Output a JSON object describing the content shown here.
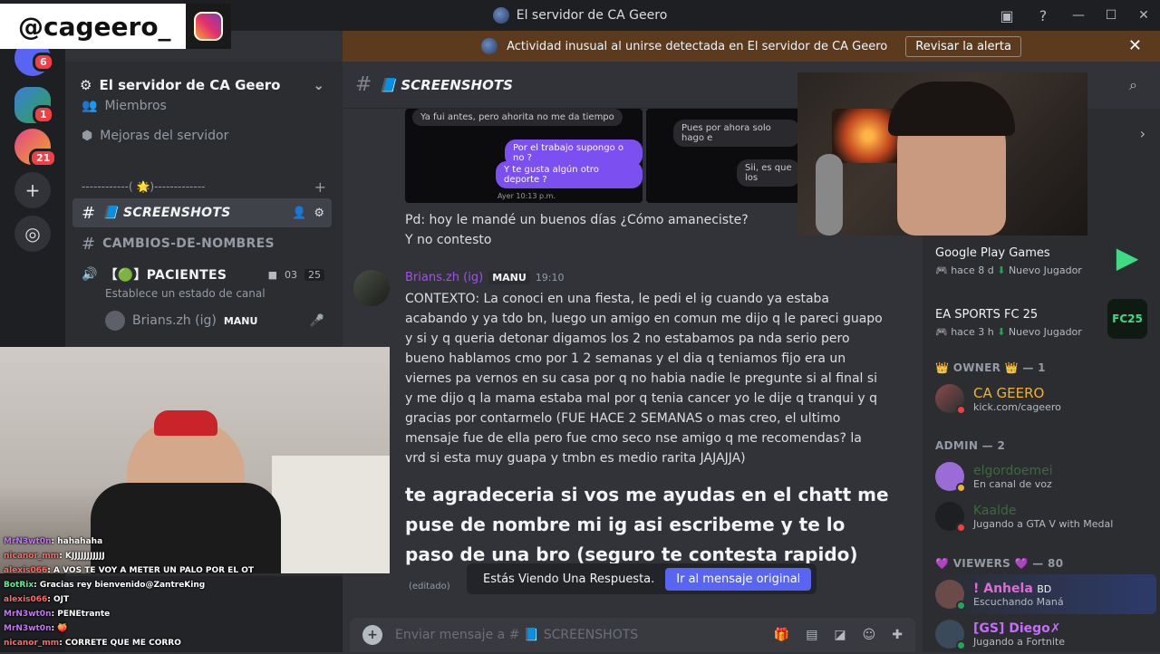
{
  "window": {
    "title": "El servidor de CA Geero"
  },
  "overlay": {
    "handle": "@cageero_"
  },
  "alert": {
    "text": "Actividad inusual al unirse detectada en El servidor de CA Geero",
    "review": "Revisar la alerta",
    "close": "✕"
  },
  "rail": {
    "badges": [
      "6",
      "1",
      "21"
    ]
  },
  "sidebar": {
    "server_name": "El servidor de CA Geero",
    "items": [
      {
        "label": "Miembros"
      },
      {
        "label": "Mejoras del servidor"
      }
    ],
    "category": "------------( 🌟)-------------",
    "channels": [
      {
        "name": "📘 SCREENSHOTS"
      },
      {
        "name": "CAMBIOS-DE-NOMBRES"
      },
      {
        "name": "【🟢】PACIENTES",
        "count1": "03",
        "count2": "25",
        "status": "Establece un estado de canal"
      }
    ],
    "voice_user": {
      "name": "Brians.zh (ig)",
      "tag": "MANU"
    }
  },
  "chat": {
    "channel": "📘 SCREENSHOTS",
    "img_bubbles": [
      "Ya fui antes, pero ahorita no me da tiempo",
      "Por el trabajo supongo o no ?",
      "Y te gusta algún otro deporte ?",
      "Ayer 10:13 p.m.",
      "Pues por ahora solo hago e",
      "Sii, es que los"
    ],
    "prev_text_1": "Pd: hoy le mandé un buenos días ¿Cómo amaneciste?",
    "prev_text_2": "Y no contesto",
    "author": "Brians.zh (ig)",
    "author_tag": "MANU",
    "time": "19:10",
    "body": "CONTEXTO: La conoci en una fiesta, le pedi el ig cuando ya estaba acabando y ya  tdo bn, luego un amigo en comun me dijo q le pareci guapo y  si y q queria detonar digamos los 2 no estabamos pa nda serio pero bueno hablamos cmo por  1  2 semanas y  el dia  q teniamos fijo era un  viernes  pa vernos en su casa  por q no habia nadie le pregunte si al final si y me dijo q la mama estaba mal por q tenia  cancer  yo le dije  q  tranqui y  q gracias por contarmelo (FUE HACE 2 SEMANAS o mas creo, el ultimo mensaje fue de ella pero fue cmo seco nse amigo q me recomendas? la vrd si esta muy guapa y tmbn es  medio  rarita JAJAJJA)",
    "big": "te agradeceria  si vos me ayudas en el chatt me puse de nombre mi ig asi escribeme y te lo paso de una bro (seguro te contesta rapido)",
    "edited": "(editado)",
    "reply_banner": "Estás Viendo Una Respuesta.",
    "reply_go": "Ir al mensaje original",
    "composer_placeholder": "Enviar mensaje a # 📘 SCREENSHOTS"
  },
  "members": {
    "activities": [
      {
        "title": "Google Play Games",
        "sub": "hace 8 d",
        "status": "Nuevo Jugador"
      },
      {
        "title": "EA SPORTS FC 25",
        "sub": "hace 3 h",
        "status": "Nuevo Jugador"
      }
    ],
    "owner_section": "👑 OWNER 👑 — 1",
    "owner": {
      "name": "CA GEERO",
      "sub": "kick.com/cageero"
    },
    "admin_section": "ADMIN — 2",
    "admins": [
      {
        "name": "elgordoemei",
        "sub": "En canal de voz"
      },
      {
        "name": "Kaalde",
        "sub": "Jugando a GTA V with Medal"
      }
    ],
    "viewers_section": "💜 VIEWERS 💜 — 80",
    "viewers": [
      {
        "name": "! Anhela",
        "tag": "BD",
        "sub": "Escuchando Maná"
      },
      {
        "name": "[GS] Diego✗",
        "sub": "Jugando a Fortnite"
      }
    ]
  },
  "stream_chat": [
    {
      "user": "MrN3wt0n",
      "msg": "hahahaha"
    },
    {
      "user": "nicanor_mm",
      "msg": "KJJJJJJJJJJJ"
    },
    {
      "user": "alexis066",
      "msg": "A VOS TE VOY A METER UN PALO POR EL OT"
    },
    {
      "user": "BotRix",
      "msg": "Gracias rey bienvenido@ZantreKing"
    },
    {
      "user": "alexis066",
      "msg": "OJT"
    },
    {
      "user": "MrN3wt0n",
      "msg": "PENEtrante"
    },
    {
      "user": "MrN3wt0n",
      "msg": "🍑"
    },
    {
      "user": "nicanor_mm",
      "msg": "CORRETE QUE ME CORRO"
    }
  ],
  "colors": {
    "accent": "#5865f2",
    "alert_bg": "#5c3a1e",
    "author": "#a64df0",
    "owner": "#f0b232"
  }
}
